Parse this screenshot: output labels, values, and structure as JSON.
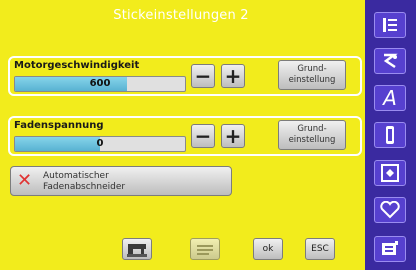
{
  "title": "Stickeinstellungen 2",
  "motor_speed": {
    "label": "Motorgeschwindigkeit",
    "value": "600",
    "level": 0.66,
    "minus": "−",
    "plus": "+",
    "reset_line1": "Grund-",
    "reset_line2": "einstellung"
  },
  "thread_tension": {
    "label": "Fadenspannung",
    "value": "0",
    "level": 0.5,
    "minus": "−",
    "plus": "+",
    "reset_line1": "Grund-",
    "reset_line2": "einstellung"
  },
  "thread_cutter": {
    "line1": "Automatischer",
    "line2": "Fadenabschneider",
    "state_icon": "x-icon"
  },
  "bottom": {
    "ok": "ok",
    "esc": "ESC"
  },
  "sidebar": {
    "icons": [
      "menu-list-icon",
      "thread-stitch-icon",
      "font-a-icon",
      "bobbin-icon",
      "embroidery-hoop-icon",
      "heart-icon",
      "setup-icon"
    ],
    "a_label": "A"
  },
  "colors": {
    "background": "#f2ec1c",
    "sidebar": "#3a2aa0",
    "slider_fill": "#6cc4e0"
  }
}
